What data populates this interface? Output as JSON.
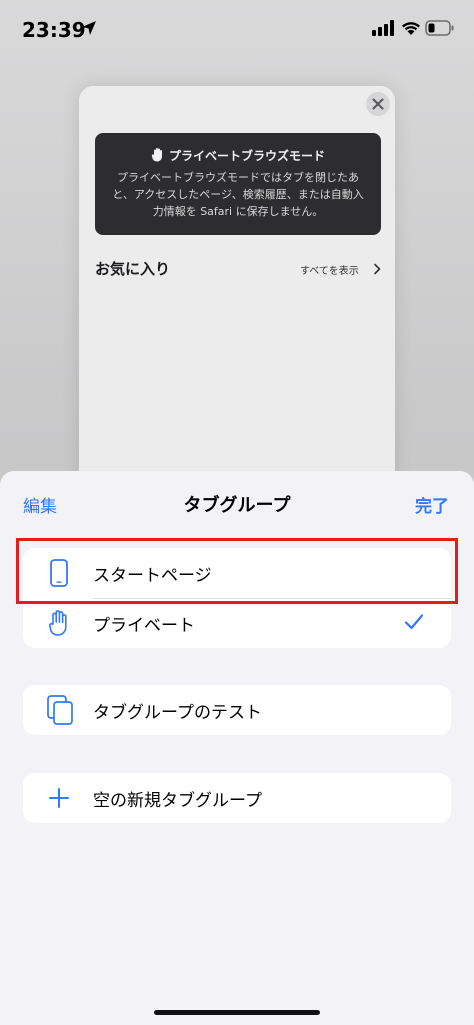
{
  "status_bar": {
    "time": "23:39"
  },
  "background_tab": {
    "private_notice_title": "プライベートブラウズモード",
    "private_notice_body": "プライベートブラウズモードではタブを閉じたあと、アクセスしたページ、検索履歴、または自動入力情報を Safari に保存しません。",
    "favorites_title": "お気に入り",
    "show_all": "すべてを表示"
  },
  "sheet": {
    "edit": "編集",
    "title": "タブグループ",
    "done": "完了",
    "groups": [
      {
        "label": "スタートページ",
        "icon": "iphone-icon",
        "selected": false,
        "highlighted": true
      },
      {
        "label": "プライベート",
        "icon": "hand-icon",
        "selected": true
      },
      {
        "label": "タブグループのテスト",
        "icon": "tabs-icon",
        "selected": false
      },
      {
        "label": "空の新規タブグループ",
        "icon": "plus-icon",
        "selected": false
      }
    ]
  },
  "colors": {
    "accent": "#3478f6",
    "highlight_border": "#e31c1c",
    "sheet_bg": "#f2f2f7"
  }
}
